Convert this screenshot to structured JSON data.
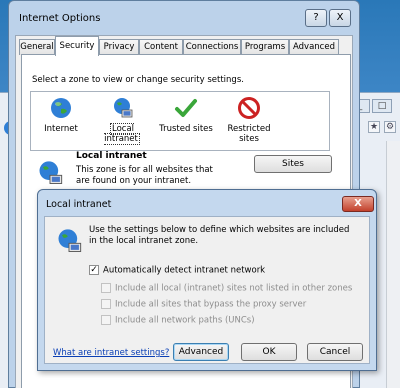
{
  "io_dialog": {
    "title": "Internet Options",
    "help_glyph": "?",
    "close_glyph": "X",
    "tabs": [
      "General",
      "Security",
      "Privacy",
      "Content",
      "Connections",
      "Programs",
      "Advanced"
    ],
    "active_tab": "Security",
    "zone_prompt": "Select a zone to view or change security settings.",
    "zones": [
      {
        "label": "Internet",
        "icon": "globe-icon"
      },
      {
        "label": "Local intranet",
        "icon": "intranet-icon",
        "selected": true
      },
      {
        "label": "Trusted sites",
        "icon": "checkmark-icon"
      },
      {
        "label": "Restricted sites",
        "icon": "no-entry-icon"
      }
    ],
    "zone_title": "Local intranet",
    "zone_desc": "This zone is for all websites that are found on your intranet.",
    "sites_button": "Sites"
  },
  "li_dialog": {
    "title": "Local intranet",
    "close_glyph": "X",
    "intro": "Use the settings below to define which websites are included in the local intranet zone.",
    "options": [
      {
        "label": "Automatically detect intranet network",
        "checked": true,
        "enabled": true
      },
      {
        "label": "Include all local (intranet) sites not listed in other zones",
        "checked": false,
        "enabled": false
      },
      {
        "label": "Include all sites that bypass the proxy server",
        "checked": false,
        "enabled": false
      },
      {
        "label": "Include all network paths (UNCs)",
        "checked": false,
        "enabled": false
      }
    ],
    "help_link": "What are intranet settings?",
    "buttons": {
      "advanced": "Advanced",
      "ok": "OK",
      "cancel": "Cancel"
    }
  },
  "browser": {
    "ie_glyph": "e",
    "window_buttons": [
      "_",
      "□"
    ],
    "toolbar_glyphs": [
      "★",
      "⚙"
    ]
  },
  "colors": {
    "link": "#0a3fb5",
    "close_red": "#c2412c",
    "trusted_green": "#3aa63a",
    "restricted_red": "#cc2222",
    "globe_blue": "#2f7fd6"
  }
}
